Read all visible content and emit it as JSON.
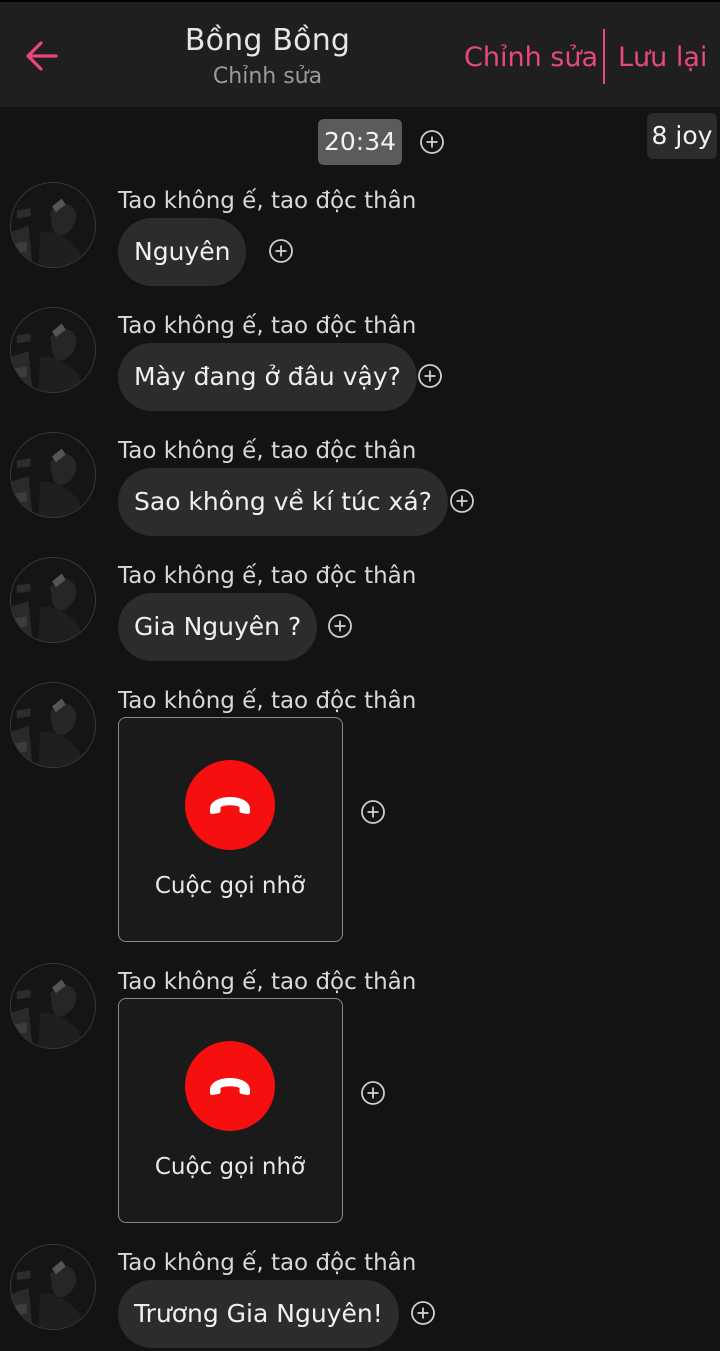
{
  "header": {
    "title": "Bồng Bồng",
    "subtitle": "Chỉnh sửa",
    "edit_label": "Chỉnh sửa",
    "save_label": "Lưu lại",
    "back_icon": "arrow-left-icon",
    "accent_color": "#e8477f"
  },
  "time_badge": "20:34",
  "joy_badge": "8 joy",
  "messages": [
    {
      "sender": "Tao không ế, tao độc thân",
      "type": "text",
      "text": "Nguyên"
    },
    {
      "sender": "Tao không ế, tao độc thân",
      "type": "text",
      "text": "Mày đang ở đâu vậy?"
    },
    {
      "sender": "Tao không ế, tao độc thân",
      "type": "text",
      "text": "Sao không về kí túc xá?"
    },
    {
      "sender": "Tao không ế, tao độc thân",
      "type": "text",
      "text": "Gia Nguyên ?"
    },
    {
      "sender": "Tao không ế, tao độc thân",
      "type": "missed_call",
      "text": "Cuộc gọi nhỡ"
    },
    {
      "sender": "Tao không ế, tao độc thân",
      "type": "missed_call",
      "text": "Cuộc gọi nhỡ"
    },
    {
      "sender": "Tao không ế, tao độc thân",
      "type": "text",
      "text": "Trương Gia Nguyên!"
    }
  ],
  "colors": {
    "background": "#131313",
    "bubble": "#2c2c2c",
    "missed_call": "#f50f0f"
  }
}
